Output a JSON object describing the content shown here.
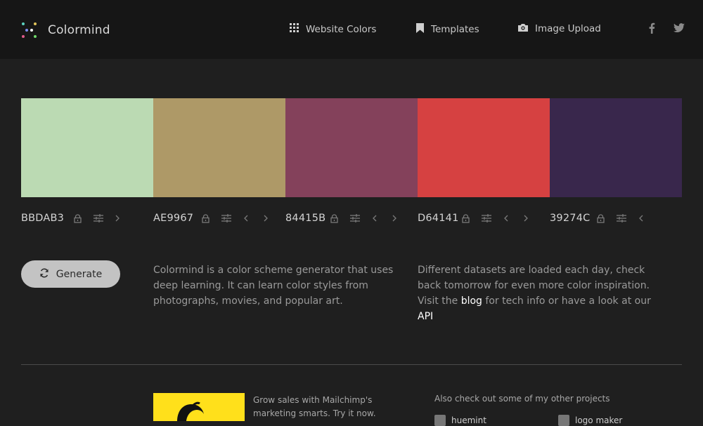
{
  "header": {
    "brand": "Colormind",
    "nav": [
      {
        "label": "Website Colors",
        "icon": "grid-icon"
      },
      {
        "label": "Templates",
        "icon": "bookmark-icon"
      },
      {
        "label": "Image Upload",
        "icon": "camera-icon"
      }
    ],
    "social": [
      {
        "label": "f",
        "icon": "facebook-icon"
      },
      {
        "label": "twitter",
        "icon": "twitter-icon"
      }
    ]
  },
  "palette": [
    {
      "hex": "BBDAB3",
      "color": "#BBDAB3"
    },
    {
      "hex": "AE9967",
      "color": "#AE9967"
    },
    {
      "hex": "84415B",
      "color": "#84415B"
    },
    {
      "hex": "D64141",
      "color": "#D64141"
    },
    {
      "hex": "39274C",
      "color": "#39274C"
    }
  ],
  "generate": {
    "label": "Generate"
  },
  "intro": {
    "text": "Colormind is a color scheme generator that uses deep learning. It can learn color styles from photographs, movies, and popular art."
  },
  "info": {
    "text_before": "Different datasets are loaded each day, check back tomorrow for even more color inspiration. Visit the ",
    "blog_link": "blog",
    "text_middle": " for tech info or have a look at our ",
    "api_link": "API"
  },
  "ad": {
    "text": "Grow sales with Mailchimp's marketing smarts. Try it now."
  },
  "projects": {
    "title": "Also check out some of my other projects",
    "items": [
      {
        "label": "huemint"
      },
      {
        "label": "logo maker"
      }
    ]
  },
  "colors": {
    "background": "#1f1f1f",
    "header": "#161616",
    "generate_button": "#c3c3c3",
    "mailchimp_yellow": "#ffe01b"
  }
}
